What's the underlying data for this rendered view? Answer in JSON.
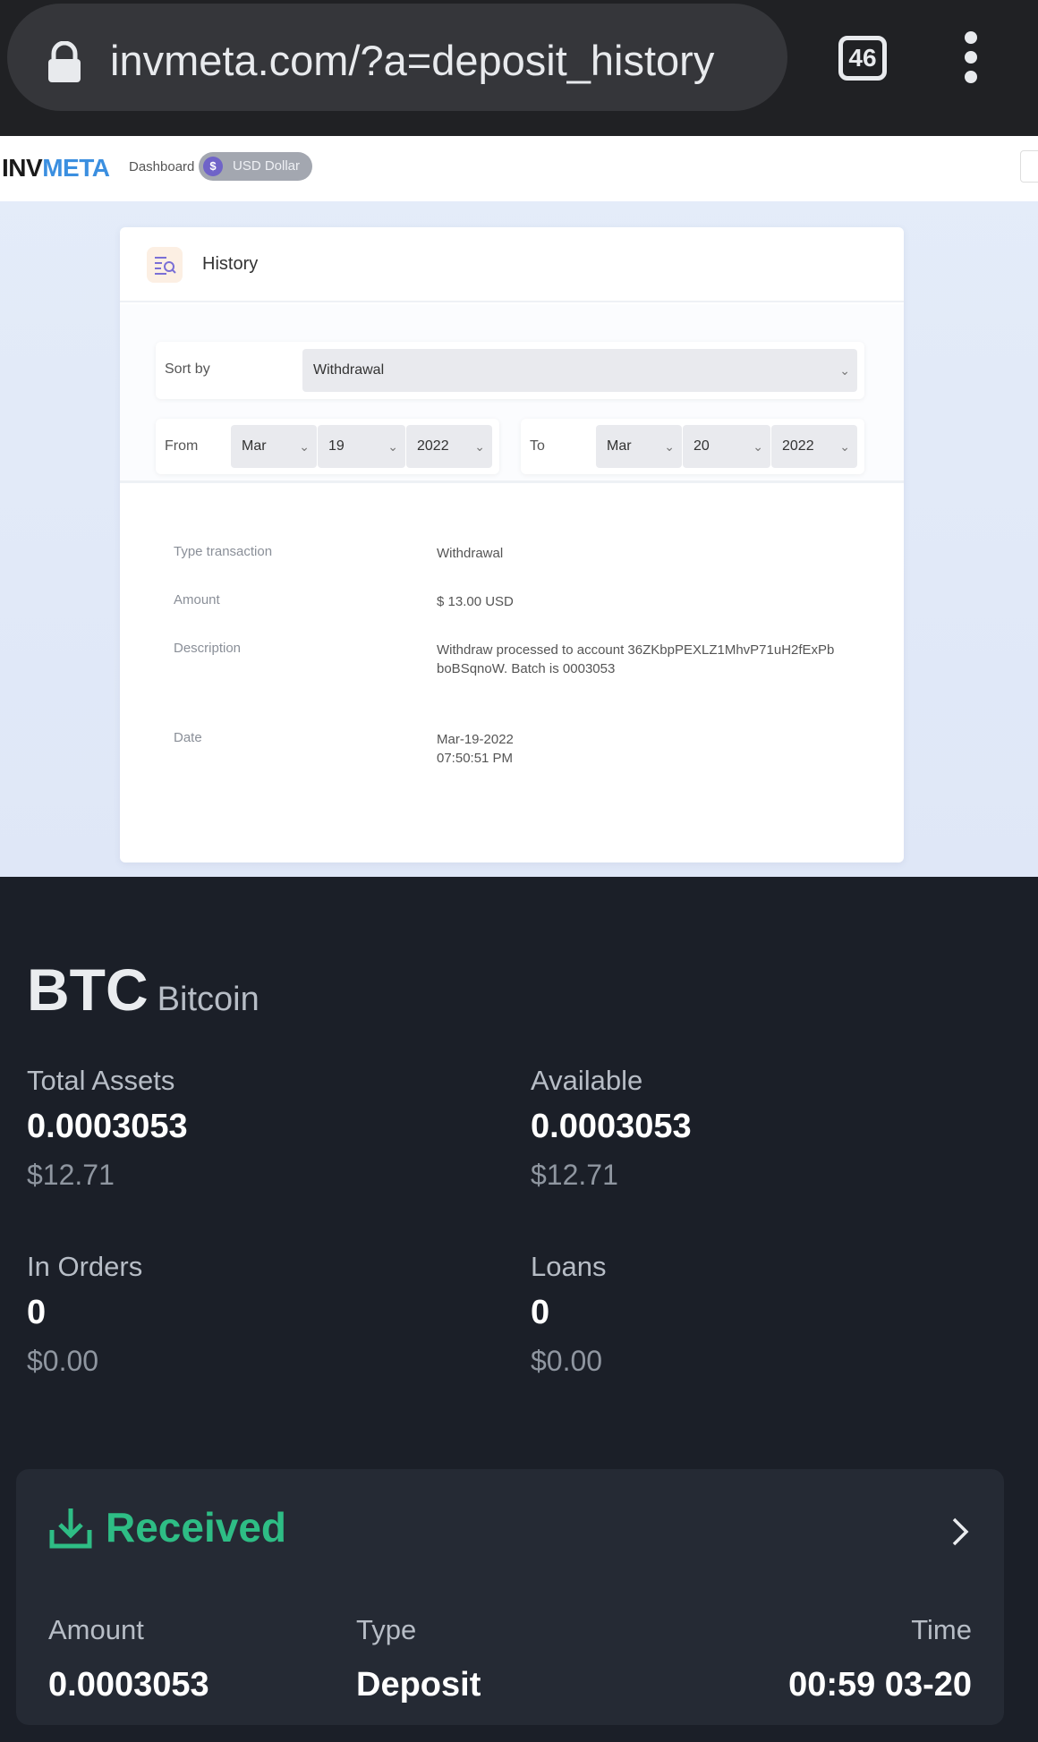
{
  "browser": {
    "url": "invmeta.com/?a=deposit_history",
    "tab_count": "46"
  },
  "site": {
    "logo_part1": "INV",
    "logo_part2": "META",
    "nav_dashboard": "Dashboard",
    "currency_label": "USD Dollar",
    "currency_symbol": "$"
  },
  "history_card": {
    "title": "History",
    "sort_label": "Sort by",
    "sort_value": "Withdrawal",
    "from_label": "From",
    "from_month": "Mar",
    "from_day": "19",
    "from_year": "2022",
    "to_label": "To",
    "to_month": "Mar",
    "to_day": "20",
    "to_year": "2022",
    "rows": {
      "type_label": "Type transaction",
      "type_value": "Withdrawal",
      "amount_label": "Amount",
      "amount_value": "$ 13.00 USD",
      "description_label": "Description",
      "description_value": "Withdraw processed to account 36ZKbpPEXLZ1MhvP71uH2fExPbboBSqnoW. Batch is 0003053",
      "date_label": "Date",
      "date_value_line1": "Mar-19-2022",
      "date_value_line2": "07:50:51 PM"
    }
  },
  "crypto": {
    "symbol": "BTC",
    "name": "Bitcoin",
    "total_assets": {
      "label": "Total Assets",
      "value": "0.0003053",
      "usd": "$12.71"
    },
    "available": {
      "label": "Available",
      "value": "0.0003053",
      "usd": "$12.71"
    },
    "in_orders": {
      "label": "In Orders",
      "value": "0",
      "usd": "$0.00"
    },
    "loans": {
      "label": "Loans",
      "value": "0",
      "usd": "$0.00"
    },
    "received": {
      "title": "Received",
      "amount_label": "Amount",
      "amount_value": "0.0003053",
      "type_label": "Type",
      "type_value": "Deposit",
      "time_label": "Time",
      "time_value": "00:59 03-20"
    }
  },
  "icons": {
    "lock": "lock-icon",
    "menu": "more-vert-icon",
    "history": "history-search-icon",
    "received": "download-tray-icon",
    "chevron": "chevron-right-icon"
  },
  "colors": {
    "accent_green": "#2ebd85",
    "logo_blue": "#3b8fe0",
    "panel_bg": "#1b1f28"
  }
}
